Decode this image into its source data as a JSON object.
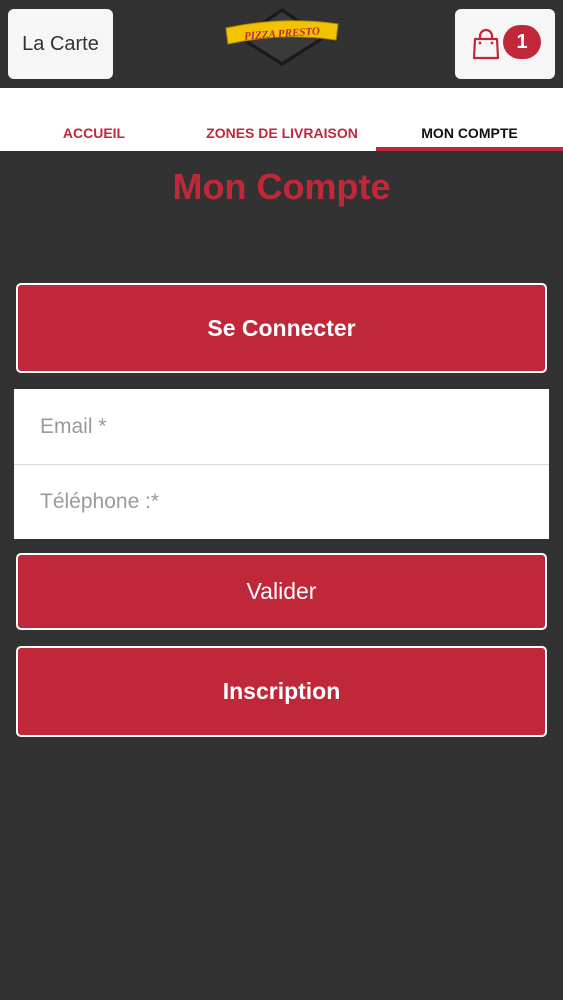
{
  "header": {
    "menu_label": "La Carte",
    "logo_text": "PIZZA PRESTO",
    "cart_count": "1"
  },
  "tabs": [
    {
      "label": "ACCUEIL",
      "active": false
    },
    {
      "label": "ZONES DE LIVRAISON",
      "active": false
    },
    {
      "label": "MON COMPTE",
      "active": true
    }
  ],
  "page": {
    "title": "Mon Compte",
    "login_button": "Se Connecter",
    "form": {
      "email_placeholder": "Email *",
      "phone_placeholder": "Téléphone :*"
    },
    "validate_button": "Valider",
    "signup_button": "Inscription"
  },
  "colors": {
    "accent": "#c0283a",
    "background": "#323232",
    "header_button_bg": "#f6f6f6"
  }
}
